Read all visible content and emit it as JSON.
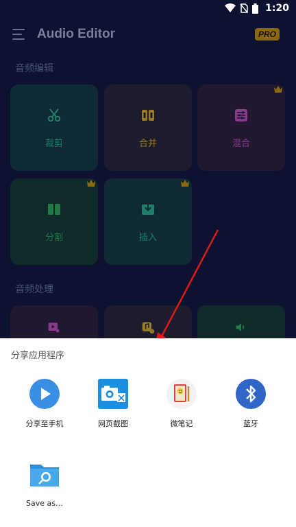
{
  "status_bar": {
    "time": "1:20"
  },
  "app_bar": {
    "title": "Audio Editor",
    "pro_badge": "PRO"
  },
  "sections": {
    "edit_title": "音频编辑",
    "process_title": "音频处理"
  },
  "tools": [
    {
      "label": "裁剪",
      "icon": "scissors-icon",
      "color": "#1f7f6a",
      "bg": "#0f2a34"
    },
    {
      "label": "合并",
      "icon": "merge-icon",
      "color": "#9a7a2a",
      "bg": "#1d1c2c"
    },
    {
      "label": "混合",
      "icon": "mix-icon",
      "color": "#8a3a8a",
      "bg": "#1f1830"
    },
    {
      "label": "分割",
      "icon": "split-icon",
      "color": "#1f7a45",
      "bg": "#102a2c"
    },
    {
      "label": "插入",
      "icon": "insert-icon",
      "color": "#1f7f6a",
      "bg": "#102a33"
    }
  ],
  "process_tools": [
    {
      "icon": "video-music-icon",
      "color": "#8a3a8a"
    },
    {
      "icon": "music-settings-icon",
      "color": "#9a7a2a"
    },
    {
      "icon": "volume-icon",
      "color": "#1f7a45"
    }
  ],
  "share_sheet": {
    "title": "分享应用程序",
    "items": [
      {
        "label": "分享至手机",
        "icon": "play-icon"
      },
      {
        "label": "网页截图",
        "icon": "camera-screenshot-icon"
      },
      {
        "label": "微笔记",
        "icon": "notebook-icon"
      },
      {
        "label": "蓝牙",
        "icon": "bluetooth-icon"
      },
      {
        "label": "Save as…",
        "icon": "folder-search-icon"
      }
    ]
  },
  "colors": {
    "background": "#0d1230",
    "share_blue": "#3a8ee6",
    "arrow_red": "#e01818"
  }
}
